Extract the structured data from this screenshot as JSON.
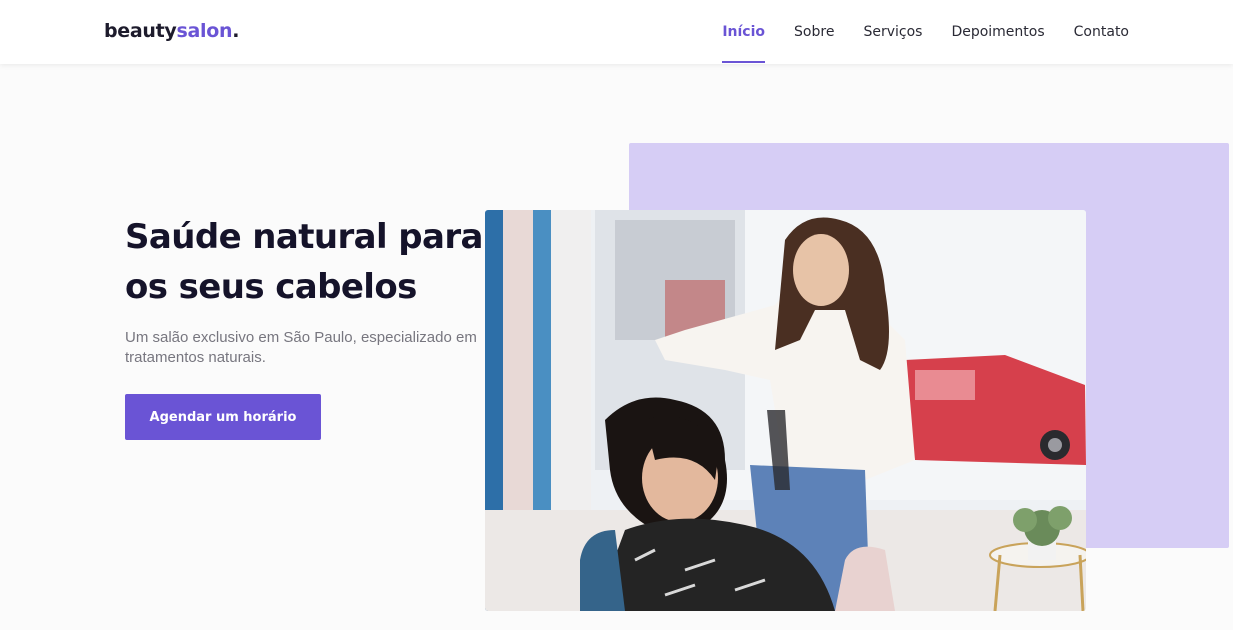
{
  "brand": {
    "name_main": "beauty",
    "name_accent": "salon",
    "name_dot": "."
  },
  "nav": {
    "items": [
      {
        "label": "Início",
        "active": true
      },
      {
        "label": "Sobre",
        "active": false
      },
      {
        "label": "Serviços",
        "active": false
      },
      {
        "label": "Depoimentos",
        "active": false
      },
      {
        "label": "Contato",
        "active": false
      }
    ]
  },
  "hero": {
    "title_line1": "Saúde natural para",
    "title_line2": "os seus cabelos",
    "description": "Um salão exclusivo em São Paulo, especializado em tratamentos naturais.",
    "cta_label": "Agendar um horário",
    "image_icon": "salon-photo"
  },
  "colors": {
    "accent": "#6a54d5",
    "accent_light": "#d6cdf5",
    "text_dark": "#15132a",
    "text_muted": "#77767f",
    "background": "#fbfbfb"
  }
}
